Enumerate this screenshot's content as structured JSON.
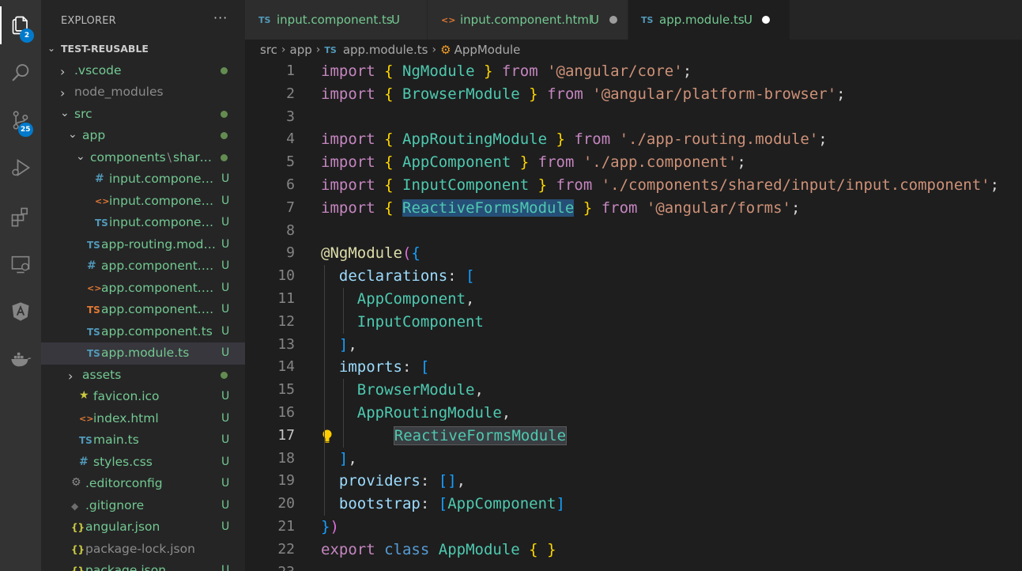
{
  "activity_bar": {
    "items": [
      {
        "icon": "files-icon",
        "badge": "2"
      },
      {
        "icon": "search-icon"
      },
      {
        "icon": "source-control-icon",
        "badge": "25"
      },
      {
        "icon": "run-debug-icon"
      },
      {
        "icon": "extensions-icon"
      },
      {
        "icon": "remote-explorer-icon"
      },
      {
        "icon": "angular-icon"
      },
      {
        "icon": "docker-icon"
      }
    ]
  },
  "sidebar": {
    "title": "EXPLORER",
    "more": "···",
    "root": "TEST-REUSABLE",
    "items": [
      {
        "label": ".vscode",
        "type": "folder",
        "decoration": "dot"
      },
      {
        "label": "node_modules",
        "type": "folder"
      },
      {
        "label": "src",
        "type": "folder",
        "decoration": "dot"
      },
      {
        "label": "app",
        "type": "folder",
        "decoration": "dot"
      },
      {
        "label": "components",
        "label_suffix": "shared",
        "type": "folder",
        "decoration": "dot"
      },
      {
        "label": "input.component.css",
        "type": "css",
        "decoration": "U"
      },
      {
        "label": "input.component.h...",
        "type": "html",
        "decoration": "U"
      },
      {
        "label": "input.component.ts",
        "type": "ts",
        "decoration": "U"
      },
      {
        "label": "app-routing.module...",
        "type": "ts",
        "decoration": "U"
      },
      {
        "label": "app.component.css",
        "type": "css",
        "decoration": "U"
      },
      {
        "label": "app.component.html",
        "type": "html",
        "decoration": "U"
      },
      {
        "label": "app.component.spe...",
        "type": "ts-spec",
        "decoration": "U"
      },
      {
        "label": "app.component.ts",
        "type": "ts",
        "decoration": "U"
      },
      {
        "label": "app.module.ts",
        "type": "ts",
        "decoration": "U"
      },
      {
        "label": "assets",
        "type": "folder",
        "decoration": "dot"
      },
      {
        "label": "favicon.ico",
        "type": "ico",
        "decoration": "U"
      },
      {
        "label": "index.html",
        "type": "html",
        "decoration": "U"
      },
      {
        "label": "main.ts",
        "type": "ts",
        "decoration": "U"
      },
      {
        "label": "styles.css",
        "type": "css",
        "decoration": "U"
      },
      {
        "label": ".editorconfig",
        "type": "config",
        "decoration": "U"
      },
      {
        "label": ".gitignore",
        "type": "git",
        "decoration": "U"
      },
      {
        "label": "angular.json",
        "type": "json",
        "decoration": "U"
      },
      {
        "label": "package-lock.json",
        "type": "json"
      },
      {
        "label": "package.json",
        "type": "json",
        "decoration": "U"
      }
    ]
  },
  "tabs": [
    {
      "icon": "TS",
      "label": "input.component.ts",
      "mark": "U"
    },
    {
      "icon": "<>",
      "label": "input.component.html",
      "mark": "U",
      "dirty": true
    },
    {
      "icon": "TS",
      "label": "app.module.ts",
      "mark": "U",
      "dirty": true,
      "active": true
    }
  ],
  "breadcrumb": {
    "parts": [
      "src",
      "app",
      "app.module.ts",
      "AppModule"
    ],
    "ts_icon": "TS"
  },
  "editor": {
    "current_line": 17,
    "lines": [
      "import { NgModule } from '@angular/core';",
      "import { BrowserModule } from '@angular/platform-browser';",
      "",
      "import { AppRoutingModule } from './app-routing.module';",
      "import { AppComponent } from './app.component';",
      "import { InputComponent } from './components/shared/input/input.component';",
      "import { ReactiveFormsModule } from '@angular/forms';",
      "",
      "@NgModule({",
      "  declarations: [",
      "    AppComponent,",
      "    InputComponent",
      "  ],",
      "  imports: [",
      "    BrowserModule,",
      "    AppRoutingModule,",
      "    ReactiveFormsModule",
      "  ],",
      "  providers: [],",
      "  bootstrap: [AppComponent]",
      "})",
      "export class AppModule { }",
      ""
    ]
  },
  "colors": {
    "activity_bar": "#333333",
    "sidebar": "#252526",
    "editor": "#1e1e1e",
    "untracked": "#73c991",
    "badge": "#007acc"
  }
}
